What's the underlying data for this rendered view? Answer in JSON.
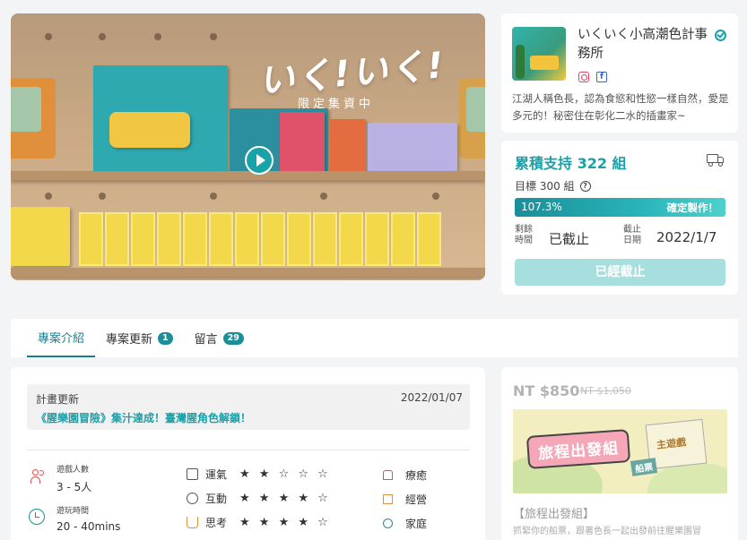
{
  "hero": {
    "title": "いく!いく!",
    "subtitle": "限定集資中"
  },
  "creator": {
    "name": "いくいく小高潮色計事務所",
    "bio": "江湖人稱色長，認為食慾和性慾一樣自然，愛是多元的！秘密住在彰化二水的插畫家~"
  },
  "funding": {
    "backers_text": "累積支持 322 組",
    "goal_text": "目標 300 組",
    "progress_percent": "107.3%",
    "progress_value": 1.073,
    "status_text": "確定製作！",
    "remaining_label": "剩餘時間",
    "remaining_value": "已截止",
    "deadline_label": "截止日期",
    "deadline_value": "2022/1/7",
    "ended_button": "已經截止"
  },
  "tabs": [
    {
      "label": "專案介紹",
      "badge": null
    },
    {
      "label": "專案更新",
      "badge": "1"
    },
    {
      "label": "留言",
      "badge": "29"
    }
  ],
  "update": {
    "heading": "計畫更新",
    "date": "2022/01/07",
    "title": "《腥樂園冒險》集汁達成！臺灣腥角色解鎖！"
  },
  "game_info": {
    "players_label": "遊戲人數",
    "players_value": "3 - 5人",
    "time_label": "遊玩時間",
    "time_value": "20 - 40mins"
  },
  "attributes": [
    {
      "label": "運氣",
      "stars": "★ ★ ☆ ☆ ☆",
      "rating": 2
    },
    {
      "label": "互動",
      "stars": "★ ★ ★ ★ ☆",
      "rating": 4
    },
    {
      "label": "思考",
      "stars": "★ ★ ★ ★ ☆",
      "rating": 4
    }
  ],
  "tags": [
    "療癒",
    "經營",
    "家庭"
  ],
  "reward": {
    "price": "NT $850",
    "original_price": "NT $1,050",
    "image_title": "旅程出發組",
    "image_box_label": "主遊戲",
    "image_ticket_label": "船票",
    "name": "【旅程出發組】",
    "desc": "抓緊你的船票，跟著色長一起出發前往腥樂園冒"
  },
  "colors": {
    "accent": "#1ba0a8",
    "tab_active": "#1b7e8f",
    "disabled_button": "#a7dfdf"
  }
}
